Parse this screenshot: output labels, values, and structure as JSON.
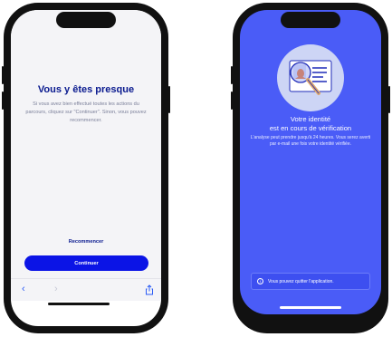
{
  "phone_left": {
    "title": "Vous y êtes presque",
    "body": "Si vous avez bien effectué toutes les actions du parcours, cliquez sur \"Continuer\". Sinon, vous pouvez recommencer.",
    "restart_link": "Recommencer",
    "continue_button": "Continuer",
    "browser": {
      "back_icon": "chevron-left-icon",
      "forward_icon": "chevron-right-icon",
      "share_icon": "share-icon"
    },
    "colors": {
      "accent": "#0b14e6",
      "title": "#0a1a8f",
      "background": "#f4f4f7"
    }
  },
  "phone_right": {
    "title_line1": "Votre identité",
    "title_line2": "est en cours de vérification",
    "body": "L'analyse peut prendre jusqu'à 24 heures. Vous serez averti par e-mail une fois votre identité vérifiée.",
    "notice": "Vous pouvez quitter l'application.",
    "illustration": "magnifier-on-id-card",
    "colors": {
      "background": "#4a5cf7",
      "text": "#ffffff"
    }
  }
}
